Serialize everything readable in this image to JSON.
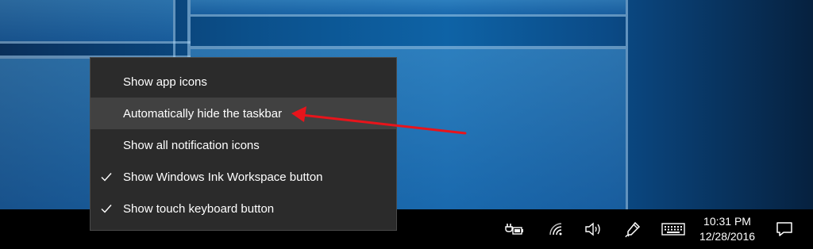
{
  "context_menu": {
    "items": [
      {
        "label": "Show app icons",
        "checked": false,
        "highlighted": false
      },
      {
        "label": "Automatically hide the taskbar",
        "checked": false,
        "highlighted": true
      },
      {
        "label": "Show all notification icons",
        "checked": false,
        "highlighted": false
      },
      {
        "label": "Show Windows Ink Workspace button",
        "checked": true,
        "highlighted": false
      },
      {
        "label": "Show touch keyboard button",
        "checked": true,
        "highlighted": false
      }
    ]
  },
  "taskbar": {
    "tray_icons": [
      "battery-power-icon",
      "wifi-icon",
      "volume-icon",
      "windows-ink-pen-icon",
      "touch-keyboard-icon"
    ],
    "clock": {
      "time": "10:31 PM",
      "date": "12/28/2016"
    },
    "action_center_icon": "action-center-icon"
  },
  "annotation": {
    "arrow_color": "#e8141b"
  },
  "colors": {
    "menu_background": "#2b2b2b",
    "menu_highlight": "#414141",
    "taskbar_background": "#000000"
  }
}
